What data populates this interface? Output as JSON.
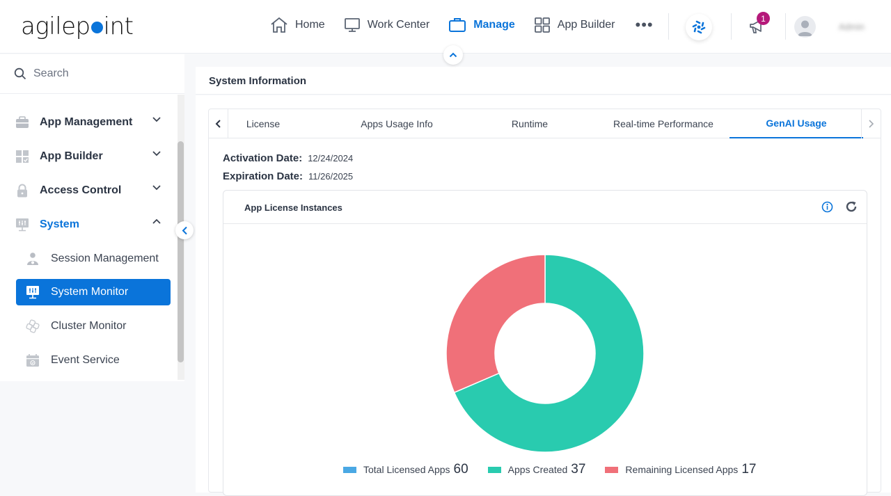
{
  "header": {
    "logo_text_before": "agilep",
    "logo_text_after": "int",
    "nav": [
      {
        "label": "Home",
        "icon": "home-icon",
        "active": false
      },
      {
        "label": "Work Center",
        "icon": "monitor-icon",
        "active": false
      },
      {
        "label": "Manage",
        "icon": "briefcase-icon",
        "active": true
      },
      {
        "label": "App Builder",
        "icon": "grid-icon",
        "active": false
      }
    ],
    "more_label": "•••",
    "notification_count": "1",
    "username": "Admin"
  },
  "sidebar": {
    "search_placeholder": "Search",
    "groups": [
      {
        "label": "App Management",
        "icon": "toolbox-icon",
        "expanded": false
      },
      {
        "label": "App Builder",
        "icon": "app-grid-icon",
        "expanded": false
      },
      {
        "label": "Access Control",
        "icon": "lock-icon",
        "expanded": false
      },
      {
        "label": "System",
        "icon": "system-icon",
        "expanded": true
      }
    ],
    "sub_items": [
      {
        "label": "Session Management",
        "icon": "user-session-icon",
        "active": false
      },
      {
        "label": "System Monitor",
        "icon": "monitor-sliders-icon",
        "active": true
      },
      {
        "label": "Cluster Monitor",
        "icon": "cluster-icon",
        "active": false
      },
      {
        "label": "Event Service",
        "icon": "calendar-icon",
        "active": false
      }
    ]
  },
  "main": {
    "title": "System Information",
    "tabs": [
      {
        "label": "License",
        "active": false
      },
      {
        "label": "Apps Usage Info",
        "active": false
      },
      {
        "label": "Runtime",
        "active": false
      },
      {
        "label": "Real-time Performance",
        "active": false
      },
      {
        "label": "GenAI Usage",
        "active": true
      }
    ],
    "activation_label": "Activation Date:",
    "activation_value": "12/24/2024",
    "expiration_label": "Expiration Date:",
    "expiration_value": "11/26/2025",
    "card_title": "App License Instances"
  },
  "colors": {
    "accent": "#0a74da",
    "total": "#4aa8e4",
    "created": "#29cbaf",
    "remaining": "#f07079"
  },
  "chart_data": {
    "type": "pie",
    "title": "App License Instances",
    "donut": true,
    "legend_position": "bottom",
    "legend": [
      {
        "name": "Total Licensed Apps",
        "value": 60,
        "color": "#4aa8e4"
      },
      {
        "name": "Apps Created",
        "value": 37,
        "color": "#29cbaf"
      },
      {
        "name": "Remaining Licensed Apps",
        "value": 17,
        "color": "#f07079"
      }
    ],
    "slices": [
      {
        "name": "Apps Created",
        "value": 37,
        "color": "#29cbaf"
      },
      {
        "name": "Remaining Licensed Apps",
        "value": 17,
        "color": "#f07079"
      }
    ]
  }
}
